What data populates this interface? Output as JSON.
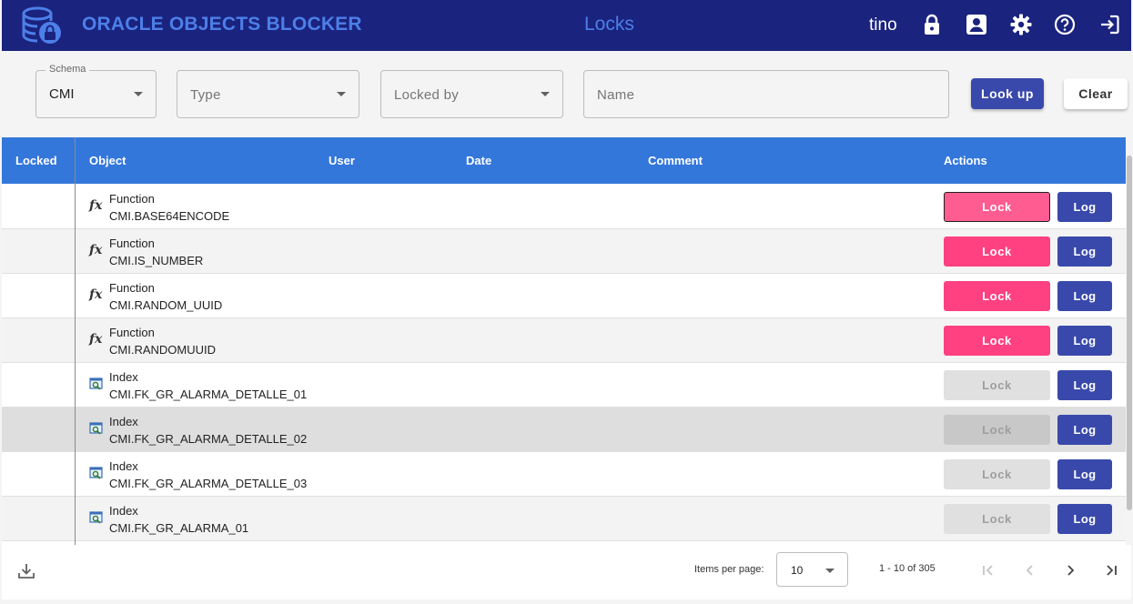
{
  "header": {
    "app_title": "ORACLE OBJECTS BLOCKER",
    "page_title": "Locks",
    "username": "tino",
    "icons": [
      "database-lock-logo-icon",
      "lock-icon",
      "account-box-icon",
      "gear-icon",
      "help-icon",
      "logout-icon"
    ]
  },
  "filters": {
    "schema": {
      "legend": "Schema",
      "value": "CMI"
    },
    "type": {
      "placeholder": "Type"
    },
    "locked_by": {
      "placeholder": "Locked by"
    },
    "name": {
      "placeholder": "Name"
    },
    "lookup_label": "Look up",
    "clear_label": "Clear"
  },
  "table": {
    "headers": {
      "locked": "Locked",
      "object": "Object",
      "user": "User",
      "date": "Date",
      "comment": "Comment",
      "actions": "Actions"
    },
    "rows": [
      {
        "type": "Function",
        "name": "CMI.BASE64ENCODE",
        "icon": "function-icon",
        "lock_label": "Lock",
        "log_label": "Log",
        "lock_state": "focused"
      },
      {
        "type": "Function",
        "name": "CMI.IS_NUMBER",
        "icon": "function-icon",
        "lock_label": "Lock",
        "log_label": "Log",
        "lock_state": "enabled"
      },
      {
        "type": "Function",
        "name": "CMI.RANDOM_UUID",
        "icon": "function-icon",
        "lock_label": "Lock",
        "log_label": "Log",
        "lock_state": "enabled"
      },
      {
        "type": "Function",
        "name": "CMI.RANDOMUUID",
        "icon": "function-icon",
        "lock_label": "Lock",
        "log_label": "Log",
        "lock_state": "enabled"
      },
      {
        "type": "Index",
        "name": "CMI.FK_GR_ALARMA_DETALLE_01",
        "icon": "index-icon",
        "lock_label": "Lock",
        "log_label": "Log",
        "lock_state": "disabled"
      },
      {
        "type": "Index",
        "name": "CMI.FK_GR_ALARMA_DETALLE_02",
        "icon": "index-icon",
        "lock_label": "Lock",
        "log_label": "Log",
        "lock_state": "disabled"
      },
      {
        "type": "Index",
        "name": "CMI.FK_GR_ALARMA_DETALLE_03",
        "icon": "index-icon",
        "lock_label": "Lock",
        "log_label": "Log",
        "lock_state": "disabled"
      },
      {
        "type": "Index",
        "name": "CMI.FK_GR_ALARMA_01",
        "icon": "index-icon",
        "lock_label": "Lock",
        "log_label": "Log",
        "lock_state": "disabled"
      }
    ]
  },
  "paginator": {
    "items_per_page_label": "Items per page:",
    "items_per_page": "10",
    "range": "1 - 10 of 305"
  },
  "colors": {
    "appbar": "#1a237e",
    "title_blue": "#4d7fe8",
    "table_header": "#3477db",
    "lock_pink": "#ff4081",
    "log_indigo": "#3949ab"
  }
}
